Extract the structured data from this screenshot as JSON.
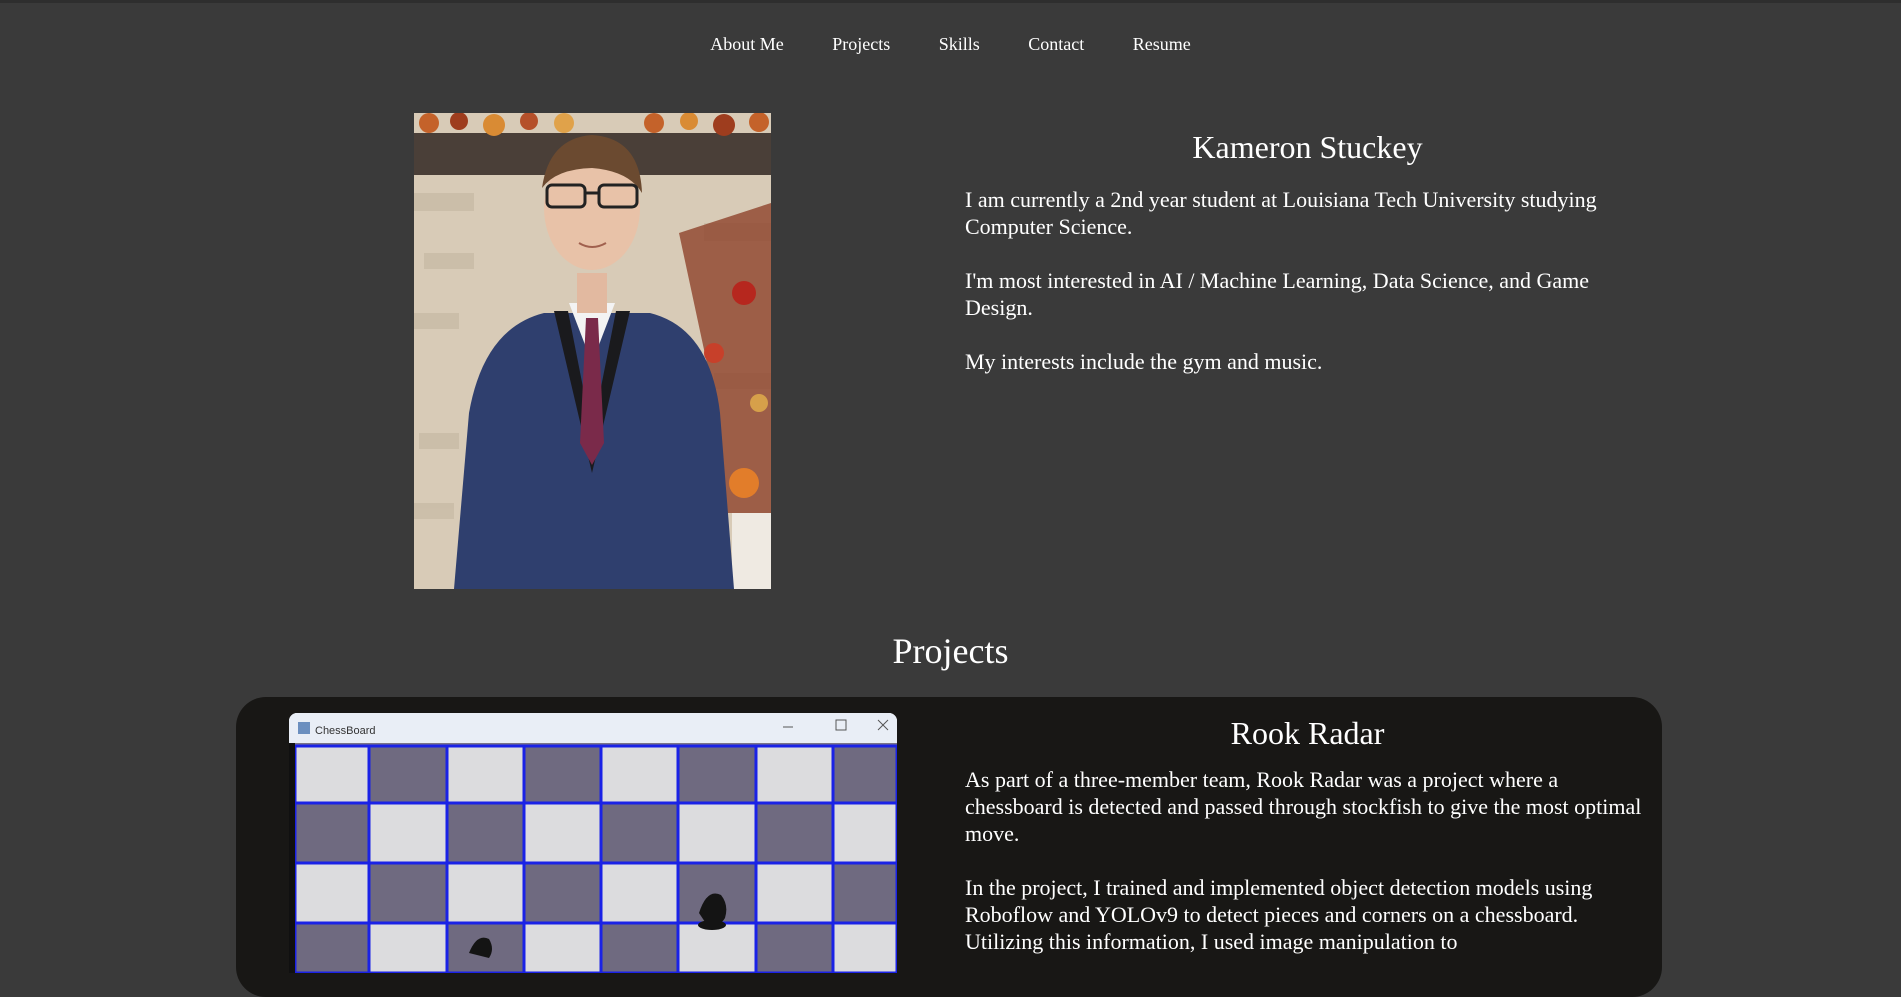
{
  "nav": {
    "items": [
      "About Me",
      "Projects",
      "Skills",
      "Contact",
      "Resume"
    ]
  },
  "about": {
    "name": "Kameron Stuckey",
    "paragraphs": [
      "I am currently a 2nd year student at Louisiana Tech University studying Computer Science.",
      "I'm most interested in AI / Machine Learning, Data Science, and Game Design.",
      "My interests include the gym and music."
    ]
  },
  "projects": {
    "title": "Projects",
    "items": [
      {
        "window_title": "ChessBoard",
        "name": "Rook Radar",
        "paragraphs": [
          "As part of a three-member team, Rook Radar was a project where a chessboard is detected and passed through stockfish to give the most optimal move.",
          "In the project, I trained and implemented object detection models using Roboflow and YOLOv9 to detect pieces and corners on a chessboard. Utilizing this information, I used image manipulation to"
        ]
      }
    ]
  },
  "colors": {
    "page_bg": "#3a3a3a",
    "card_bg": "#181715",
    "text": "#ffffff",
    "grid_line": "#1a22e6"
  }
}
